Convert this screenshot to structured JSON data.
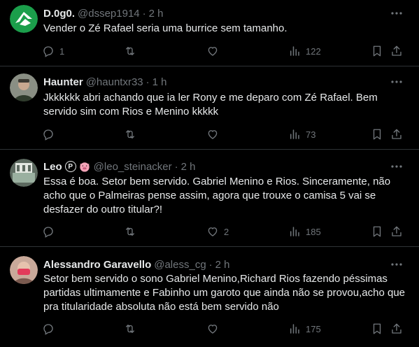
{
  "tweets": [
    {
      "name": "D.0g0.",
      "handle": "@dssep1914",
      "time": "2 h",
      "text": "Vender o Zé Rafael seria uma burrice sem tamanho.",
      "replies": "1",
      "retweets": "",
      "likes": "",
      "views": "122",
      "avatar_color": "#1b9e4b"
    },
    {
      "name": "Haunter",
      "handle": "@hauntxr33",
      "time": "1 h",
      "text": "Jkkkkkk abri achando que ia ler Rony e me deparo com Zé Rafael. Bem servido sim com Rios e Menino kkkkk",
      "replies": "",
      "retweets": "",
      "likes": "",
      "views": "73",
      "avatar_color": "#8a8f84"
    },
    {
      "name": "Leo",
      "handle": "@leo_steinacker",
      "time": "2 h",
      "badge": "P",
      "text": "Essa é boa. Setor bem servido. Gabriel Menino e Rios. Sinceramente, não acho que o Palmeiras pense assim, agora que trouxe o camisa 5 vai se desfazer do outro titular?!",
      "replies": "",
      "retweets": "",
      "likes": "2",
      "views": "185",
      "avatar_color": "#5d6a60"
    },
    {
      "name": "Alessandro Garavello",
      "handle": "@aless_cg",
      "time": "2 h",
      "text": "Setor bem servido o sono Gabriel Menino,Richard Rios fazendo péssimas partidas ultimamente e Fabinho um garoto que ainda não se provou,acho que pra titularidade absoluta não está bem servido não",
      "replies": "",
      "retweets": "",
      "likes": "",
      "views": "175",
      "avatar_color": "#c9a99a"
    }
  ],
  "separator": "·"
}
